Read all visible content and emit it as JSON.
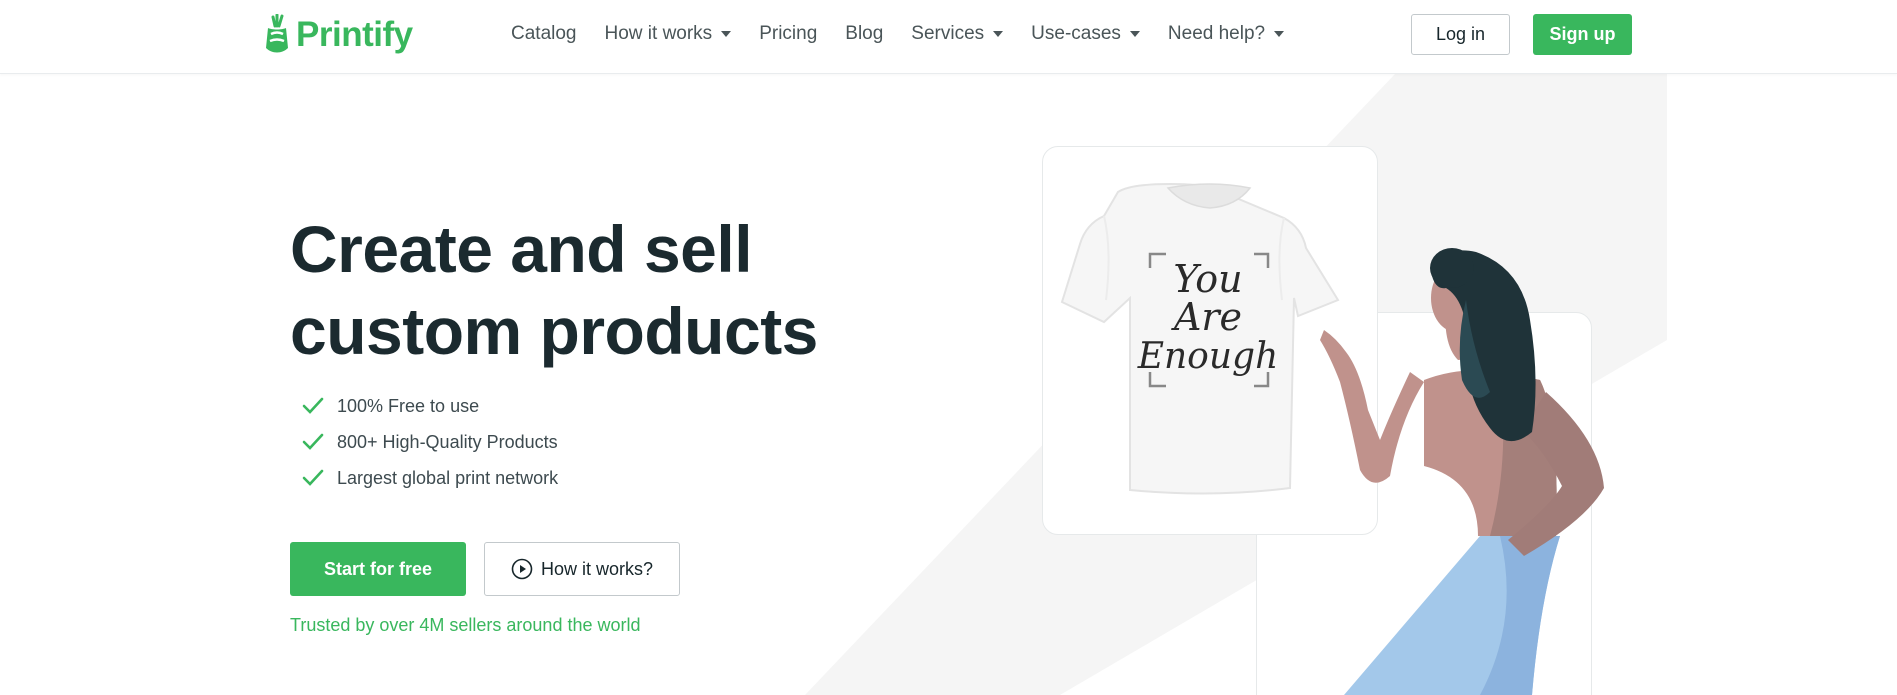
{
  "brand": {
    "name": "Printify",
    "color": "#39b75d"
  },
  "nav": {
    "items": [
      {
        "label": "Catalog",
        "has_dropdown": false
      },
      {
        "label": "How it works",
        "has_dropdown": true
      },
      {
        "label": "Pricing",
        "has_dropdown": false
      },
      {
        "label": "Blog",
        "has_dropdown": false
      },
      {
        "label": "Services",
        "has_dropdown": true
      },
      {
        "label": "Use-cases",
        "has_dropdown": true
      },
      {
        "label": "Need help?",
        "has_dropdown": true
      }
    ],
    "login_label": "Log in",
    "signup_label": "Sign up"
  },
  "hero": {
    "title": "Create and sell custom products",
    "features": [
      "100% Free to use",
      "800+ High-Quality Products",
      "Largest global print network"
    ],
    "primary_cta": "Start for free",
    "secondary_cta": "How it works?",
    "trusted_text": "Trusted by over 4M sellers around the world"
  },
  "illustration": {
    "shirt_print": [
      "You",
      "Are",
      "Enough"
    ]
  },
  "icons": {
    "logo": "printify-logo-icon",
    "check": "check-icon",
    "play": "play-circle-icon",
    "caret": "caret-down-icon"
  }
}
